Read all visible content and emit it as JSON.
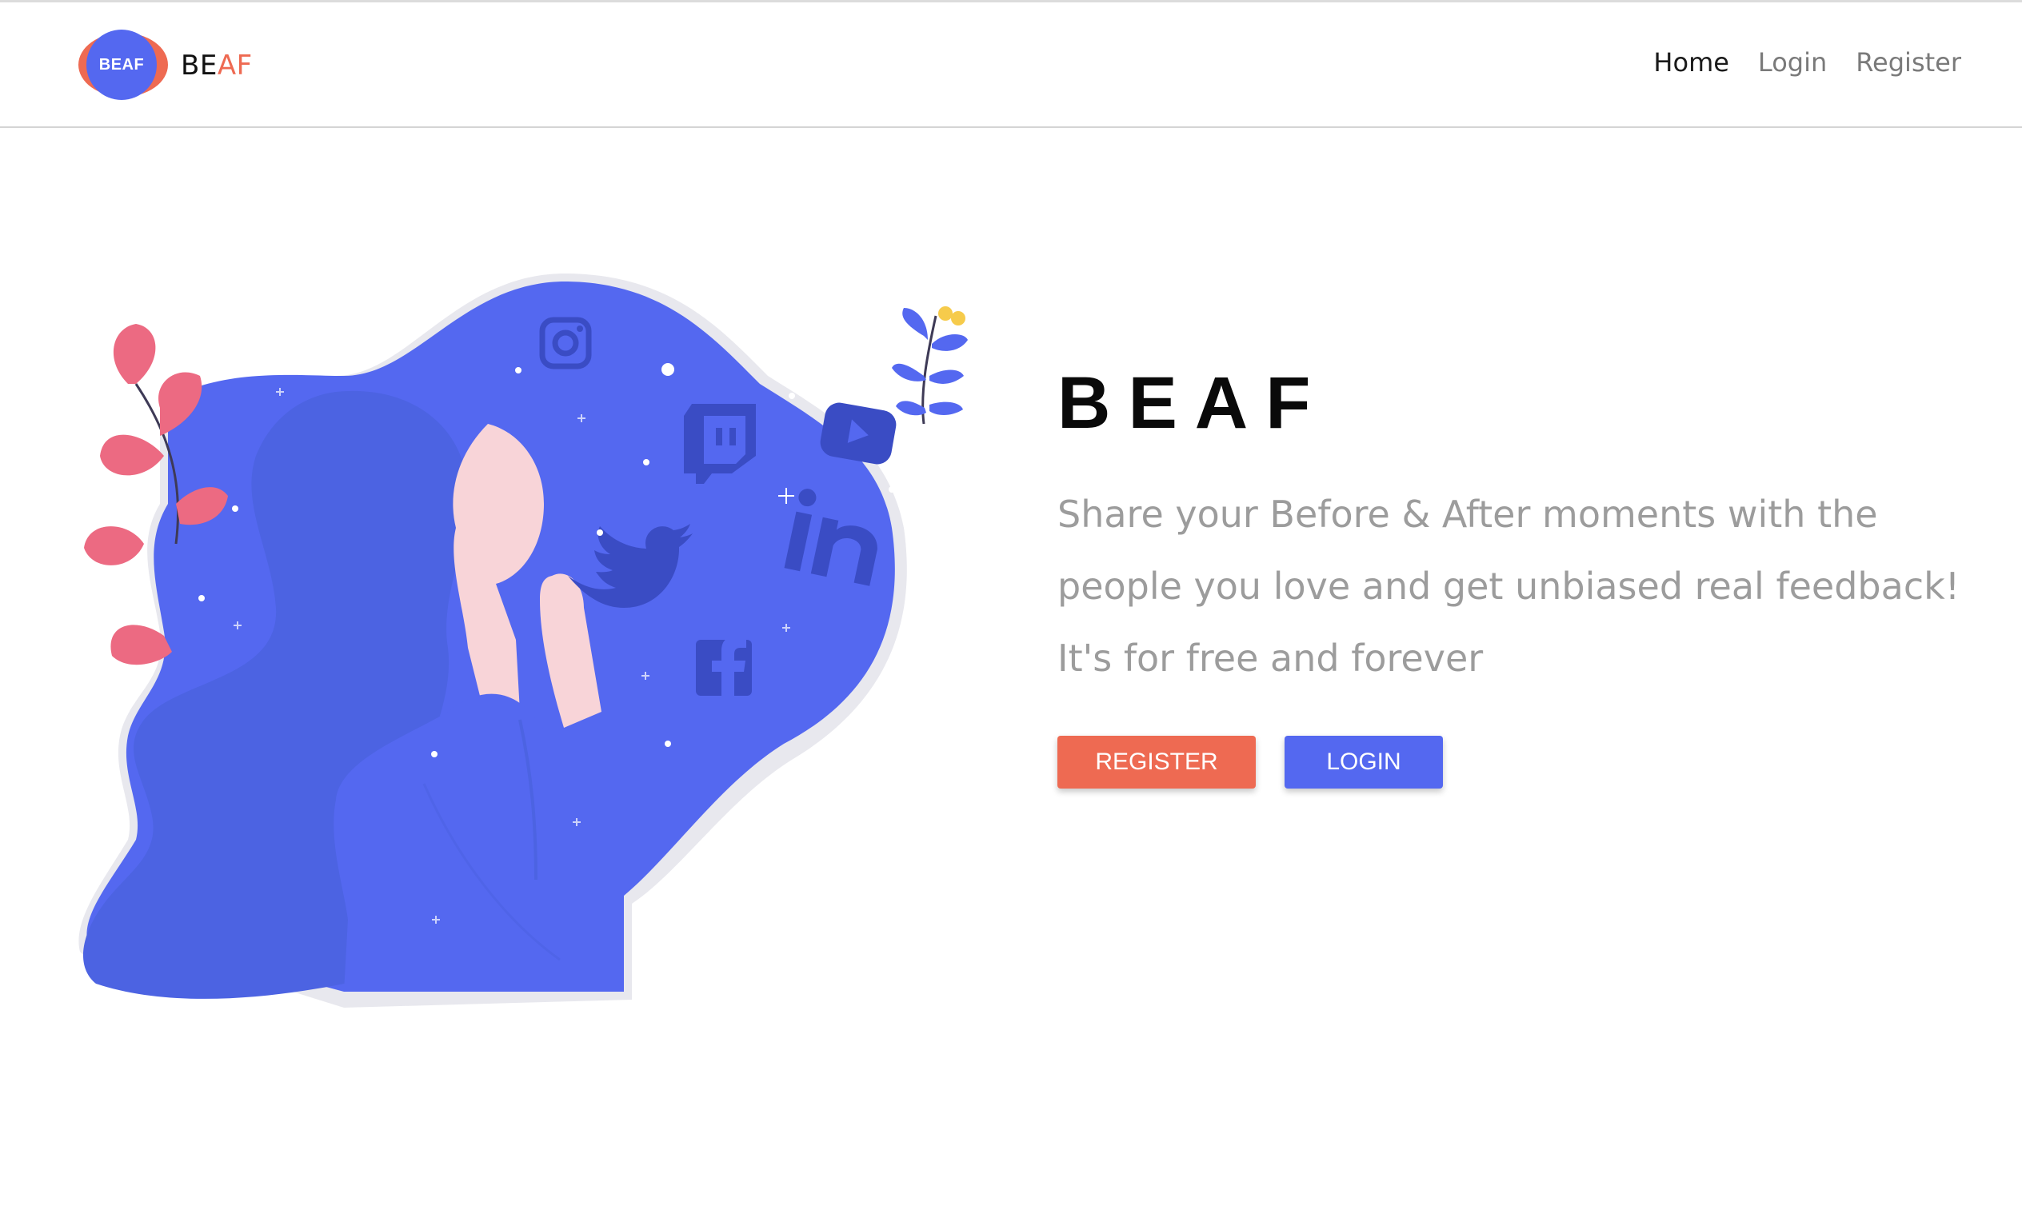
{
  "header": {
    "logo_badge_text": "BEAF",
    "brand_part1": "BE",
    "brand_part2": "AF",
    "nav": {
      "home": "Home",
      "login": "Login",
      "register": "Register"
    }
  },
  "hero": {
    "title": "BEAF",
    "tagline": "Share your Before & After moments with the people you love and get unbiased real feedback! It's for free and forever",
    "register_button": "REGISTER",
    "login_button": "LOGIN"
  },
  "colors": {
    "accent_orange": "#ee6a52",
    "accent_blue": "#5468f0",
    "title_text": "#0a0a0a",
    "muted_text": "#9c9c9c"
  },
  "icons": [
    "instagram-icon",
    "twitch-icon",
    "youtube-icon",
    "linkedin-icon",
    "twitter-icon",
    "facebook-icon"
  ]
}
